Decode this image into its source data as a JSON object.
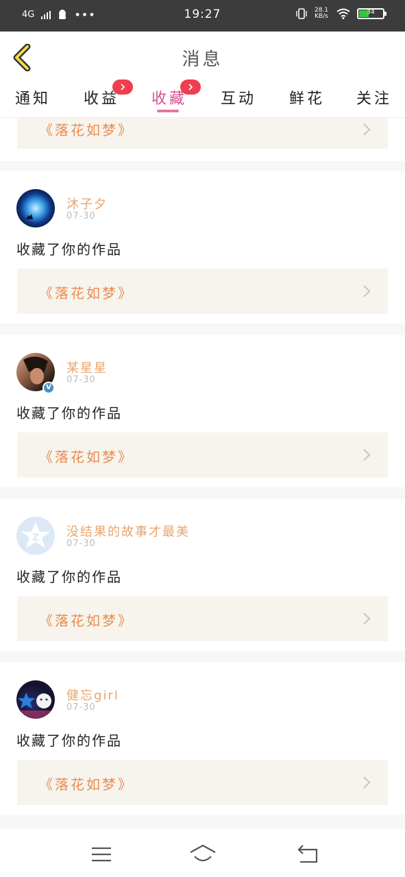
{
  "status": {
    "network": "4G",
    "time": "19:27",
    "speed": "28.1 KB/s",
    "battery": "34"
  },
  "header": {
    "title": "消息"
  },
  "tabs": [
    {
      "label": "通知"
    },
    {
      "label": "收益"
    },
    {
      "label": "收藏"
    },
    {
      "label": "互动"
    },
    {
      "label": "鲜花"
    },
    {
      "label": "关注"
    }
  ],
  "colors": {
    "accent_tab": "#d54f8f",
    "name": "#e8a56e",
    "work_title": "#ec8a4f",
    "badge": "#ef3e4f"
  },
  "top_partial": {
    "work_title": "《落花如梦》"
  },
  "items": [
    {
      "name": "沐子夕",
      "date": "07-30",
      "action": "收藏了你的作品",
      "work_title": "《落花如梦》",
      "avatar": "moon-avatar"
    },
    {
      "name": "某星星",
      "date": "07-30",
      "action": "收藏了你的作品",
      "work_title": "《落花如梦》",
      "avatar": "person-avatar",
      "verified": "V"
    },
    {
      "name": "没结果的故事才最美",
      "date": "07-30",
      "action": "收藏了你的作品",
      "work_title": "《落花如梦》",
      "avatar": "default-avatar"
    },
    {
      "name": "健忘girl",
      "date": "07-30",
      "action": "收藏了你的作品",
      "work_title": "《落花如梦》",
      "avatar": "cartoon-avatar"
    }
  ]
}
